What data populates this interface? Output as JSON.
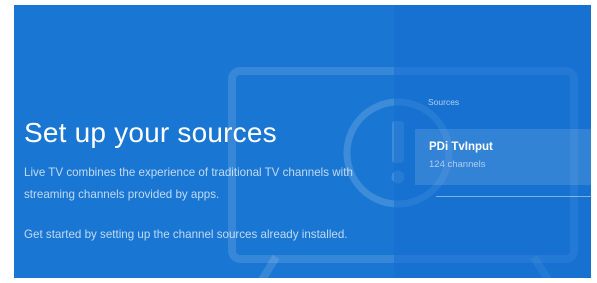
{
  "setup": {
    "title": "Set up your sources",
    "description": "Live TV combines the experience of traditional TV channels with streaming channels provided by apps.",
    "instruction": "Get started by setting up the channel sources already installed."
  },
  "sources": {
    "heading": "Sources",
    "items": [
      {
        "name": "PDi TvInput",
        "channels": "124 channels"
      }
    ]
  },
  "colors": {
    "background": "#1976d2",
    "text": "#ffffff"
  },
  "icons": {
    "illustration": "tv-alert-icon"
  }
}
